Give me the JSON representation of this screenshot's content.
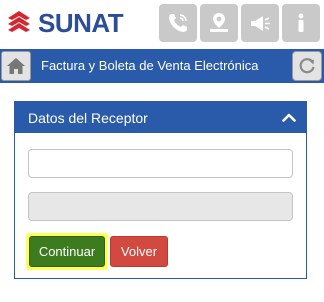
{
  "header": {
    "brand": "SUNAT",
    "icons": [
      "phone-icon",
      "map-pin-icon",
      "megaphone-icon",
      "info-icon"
    ]
  },
  "titlebar": {
    "title": "Factura y Boleta de Venta Electrónica",
    "home_icon": "home-icon",
    "refresh_icon": "refresh-icon"
  },
  "panel": {
    "title": "Datos del Receptor",
    "collapse_icon": "chevron-up-icon",
    "field1": {
      "value": "",
      "placeholder": ""
    },
    "field2": {
      "value": "",
      "placeholder": ""
    },
    "continue_label": "Continuar",
    "back_label": "Volver"
  },
  "colors": {
    "primary_blue": "#2a5bab",
    "brand_red": "#d8262f",
    "continue_green": "#3d7b1f",
    "highlight_yellow": "#ffff55",
    "back_red": "#d24a3f",
    "icon_gray": "#c9c9c9"
  }
}
